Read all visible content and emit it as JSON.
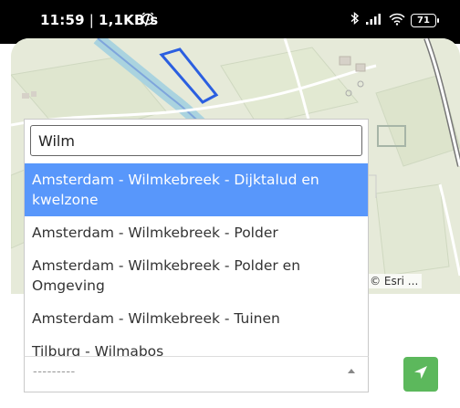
{
  "status_bar": {
    "time": "11:59",
    "speed": "1,1KB/s",
    "battery": "71"
  },
  "map": {
    "attribution": "Tiles © Esri ..."
  },
  "search": {
    "value": "Wilm"
  },
  "options": [
    {
      "label": "Amsterdam - Wilmkebreek - Dijktalud en kwelzone",
      "selected": true
    },
    {
      "label": "Amsterdam - Wilmkebreek - Polder",
      "selected": false
    },
    {
      "label": "Amsterdam - Wilmkebreek - Polder en Omgeving",
      "selected": false
    },
    {
      "label": "Amsterdam - Wilmkebreek - Tuinen",
      "selected": false
    },
    {
      "label": "Tilburg - Wilmabos",
      "selected": false
    }
  ],
  "select": {
    "placeholder": "---------"
  },
  "colors": {
    "selected_option": "#5897fb",
    "go_button": "#5cb85c"
  },
  "icons": {
    "go_button": "navigation-arrow-icon"
  }
}
